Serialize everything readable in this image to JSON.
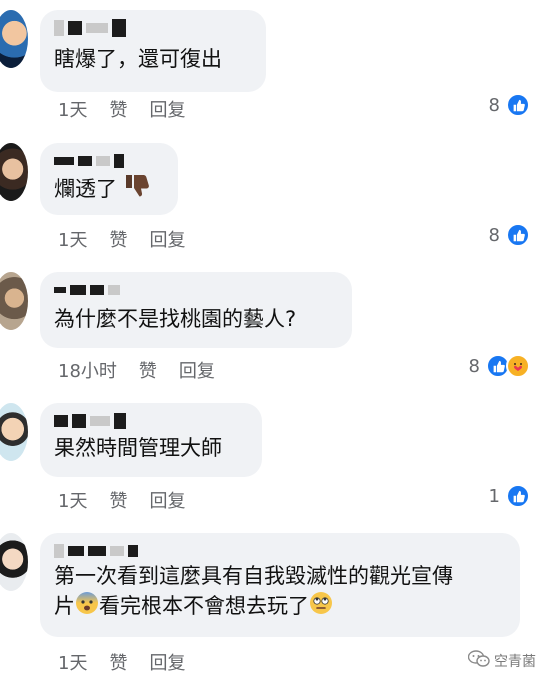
{
  "comments": [
    {
      "text": "瞎爆了，還可復出",
      "time": "1天",
      "like_label": "赞",
      "reply_label": "回复",
      "reaction_count": "8",
      "reactions": [
        "like"
      ]
    },
    {
      "text": "爛透了",
      "emoji": "thumbs-down",
      "time": "1天",
      "like_label": "赞",
      "reply_label": "回复",
      "reaction_count": "8",
      "reactions": [
        "like"
      ]
    },
    {
      "text": "為什麼不是找桃園的藝人?",
      "time": "18小时",
      "like_label": "赞",
      "reply_label": "回复",
      "reaction_count": "8",
      "reactions": [
        "like",
        "care"
      ]
    },
    {
      "text": "果然時間管理大師",
      "time": "1天",
      "like_label": "赞",
      "reply_label": "回复",
      "reaction_count": "1",
      "reactions": [
        "like"
      ]
    },
    {
      "text_line1": "第一次看到這麼具有自我毀滅性的觀光宣傳",
      "text_line2_a": "片",
      "text_line2_b": "看完根本不會想去玩了",
      "emoji_a": "fearful-face",
      "emoji_b": "eye-roll-face",
      "time": "1天",
      "like_label": "赞",
      "reply_label": "回复"
    }
  ],
  "watermark": {
    "text": "空青菌",
    "icon": "wechat-icon"
  },
  "colors": {
    "bubble": "#f0f2f5",
    "like_blue": "#1877f2",
    "meta_gray": "#65676b"
  }
}
